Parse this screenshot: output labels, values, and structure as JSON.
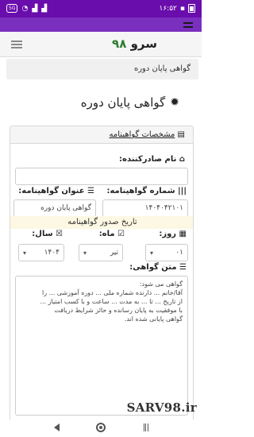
{
  "status_bar": {
    "network_badge": "5G",
    "time": "۱۶:۵۲",
    "background": "#6a0dad"
  },
  "navbar": {
    "brand_text": "سرو",
    "brand_number": "۹۸",
    "brand_number_color": "#2e7d32"
  },
  "breadcrumb": {
    "text": "گواهی پایان دوره"
  },
  "page": {
    "title": "گواهی پایان دوره",
    "title_icon": "gear-icon"
  },
  "panel": {
    "heading": "مشخصات گواهینامه",
    "heading_icon": "book-icon",
    "issuer_label": "نام صادرکننده:",
    "issuer_value": "",
    "cert_title_label": "عنوان گواهینامه:",
    "cert_title_value": "گواهی پایان دوره",
    "cert_number_label": "شماره گواهینامه:",
    "cert_number_value": "۱۴۰۴۰۴۲۱۰۱",
    "date_strip": "تاریخ صدور گواهینامه",
    "day_label": "روز:",
    "day_value": "۰۱",
    "month_label": "ماه:",
    "month_value": "تیر",
    "year_label": "سال:",
    "year_value": "۱۴۰۴",
    "body_label": "متن گواهی:",
    "body_text": "گواهی می شود:\nآقا/خانم ... دارنده شماره ملی ... دوره آموزشی ... را\nاز تاریخ ... تا ... به مدت ... ساعت و با کسب امتیاز ...\nبا موفقیت به پایان رسانده و حائز شرایط دریافت\nگواهی پایانی شده اند."
  },
  "watermark": "SARV98.ir"
}
